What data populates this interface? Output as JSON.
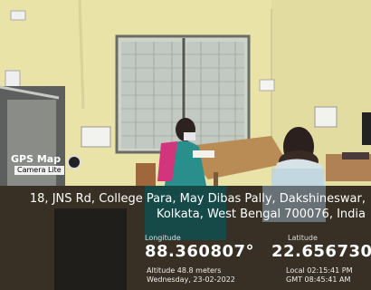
{
  "watermark": {
    "title": "GPS Map",
    "subtitle": "Camera Lite"
  },
  "address": "18, JNS Rd, College Para, May Dibas Pally, Dakshineswar, Kolkata, West Bengal 700076, India",
  "latitude": {
    "label": "Latitude",
    "value": "22.656730°"
  },
  "longitude": {
    "label": "Longitude",
    "value": "88.360807°"
  },
  "time": {
    "local": "Local 02:15:41 PM",
    "gmt": "GMT 08:45:41 AM"
  },
  "altitude": {
    "line": "Altitude 48.8 meters",
    "date": "Wednesday, 23-02-2022"
  }
}
